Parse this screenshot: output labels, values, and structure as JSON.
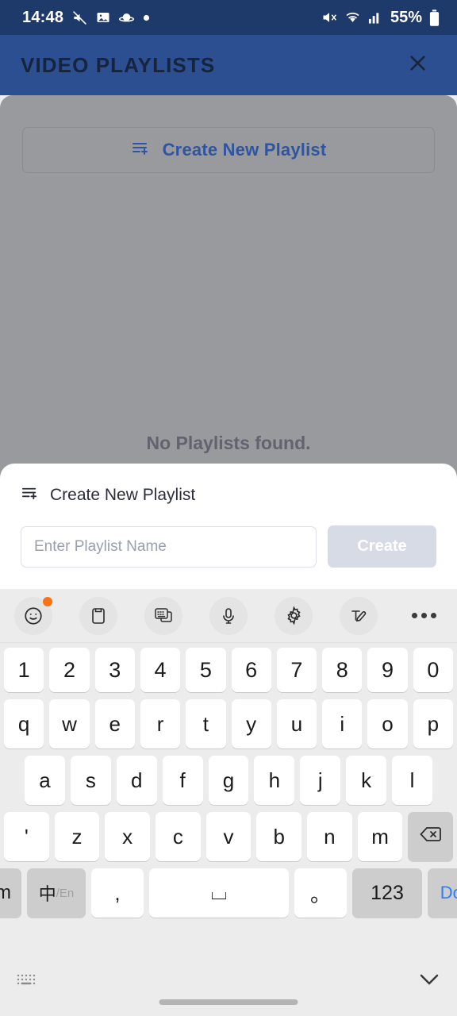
{
  "status_bar": {
    "time": "14:48",
    "battery_percent": "55%",
    "left_icons": [
      "mute-slash-icon",
      "image-icon",
      "saturn-icon",
      "dot-icon"
    ],
    "right_icons": [
      "volume-mute-icon",
      "wifi-icon",
      "signal-icon",
      "battery-icon"
    ],
    "background_color": "#1d3a6b"
  },
  "header": {
    "title": "VIDEO PLAYLISTS",
    "close_label": "close-icon",
    "background_color": "#2b4f91",
    "title_color": "#16243d"
  },
  "content": {
    "create_button_label": "Create New Playlist",
    "create_button_icon": "playlist-add-icon",
    "empty_state_text": "No Playlists found.",
    "overlay_color": "#999a9d",
    "accent_color": "#2f55a0"
  },
  "dialog": {
    "title": "Create New Playlist",
    "title_icon": "playlist-add-icon",
    "input_placeholder": "Enter Playlist Name",
    "input_value": "",
    "submit_label": "Create",
    "submit_disabled_color": "#d7dbe6"
  },
  "keyboard": {
    "toolbar": [
      {
        "name": "emoji-icon",
        "badge": true
      },
      {
        "name": "clipboard-icon",
        "badge": false
      },
      {
        "name": "stickers-keyboard-icon",
        "badge": false
      },
      {
        "name": "microphone-icon",
        "badge": false
      },
      {
        "name": "gear-icon",
        "badge": false
      },
      {
        "name": "handwriting-icon",
        "badge": false
      },
      {
        "name": "more-options-icon",
        "badge": false
      }
    ],
    "row_numbers": [
      "1",
      "2",
      "3",
      "4",
      "5",
      "6",
      "7",
      "8",
      "9",
      "0"
    ],
    "row_top": [
      "q",
      "w",
      "e",
      "r",
      "t",
      "y",
      "u",
      "i",
      "o",
      "p"
    ],
    "row_home": [
      "a",
      "s",
      "d",
      "f",
      "g",
      "h",
      "j",
      "k",
      "l"
    ],
    "row_bottom_letters": [
      "'",
      "z",
      "x",
      "c",
      "v",
      "b",
      "n",
      "m"
    ],
    "backspace_label": "backspace-icon",
    "bottom_row": {
      "sym": "Sym",
      "lang_main": "中",
      "lang_sub": "/En",
      "comma": ",",
      "space": "⌴",
      "period": "。",
      "numbers": "123",
      "done": "Done",
      "done_color": "#2d7dfb"
    },
    "footer": {
      "layout_icon": "keyboard-layout-icon",
      "hide_icon": "chevron-down-icon"
    },
    "background_color": "#ececec"
  }
}
